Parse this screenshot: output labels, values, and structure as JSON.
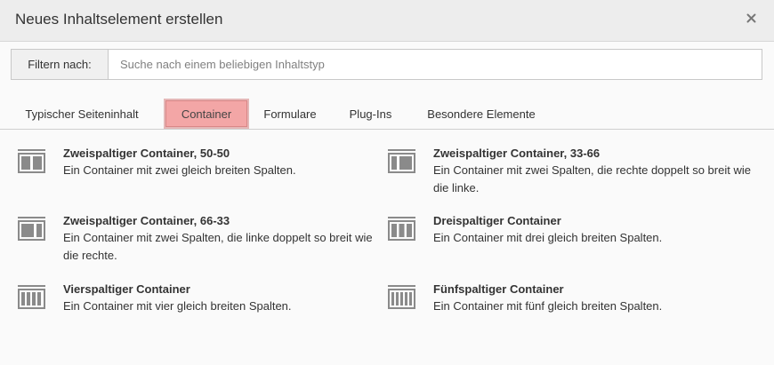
{
  "modal": {
    "title": "Neues Inhaltselement erstellen"
  },
  "filter": {
    "label": "Filtern nach:",
    "placeholder": "Suche nach einem beliebigen Inhaltstyp",
    "value": ""
  },
  "tabs": [
    {
      "label": "Typischer Seiteninhalt",
      "active": false
    },
    {
      "label": "Container",
      "active": true
    },
    {
      "label": "Formulare",
      "active": false
    },
    {
      "label": "Plug-Ins",
      "active": false
    },
    {
      "label": "Besondere Elemente",
      "active": false
    }
  ],
  "items": [
    {
      "title": "Zweispaltiger Container, 50-50",
      "description": "Ein Container mit zwei gleich breiten Spalten.",
      "icon": "container-2col-50-50-icon"
    },
    {
      "title": "Zweispaltiger Container, 33-66",
      "description": "Ein Container mit zwei Spalten, die rechte doppelt so breit wie die linke.",
      "icon": "container-2col-33-66-icon"
    },
    {
      "title": "Zweispaltiger Container, 66-33",
      "description": "Ein Container mit zwei Spalten, die linke doppelt so breit wie die rechte.",
      "icon": "container-2col-66-33-icon"
    },
    {
      "title": "Dreispaltiger Container",
      "description": "Ein Container mit drei gleich breiten Spalten.",
      "icon": "container-3col-icon"
    },
    {
      "title": "Vierspaltiger Container",
      "description": "Ein Container mit vier gleich breiten Spalten.",
      "icon": "container-4col-icon"
    },
    {
      "title": "Fünfspaltiger Container",
      "description": "Ein Container mit fünf gleich breiten Spalten.",
      "icon": "container-5col-icon"
    }
  ],
  "colors": {
    "active_tab_bg": "#f3a6a6",
    "header_bg": "#ededed",
    "icon_gray": "#8a8a8a"
  }
}
